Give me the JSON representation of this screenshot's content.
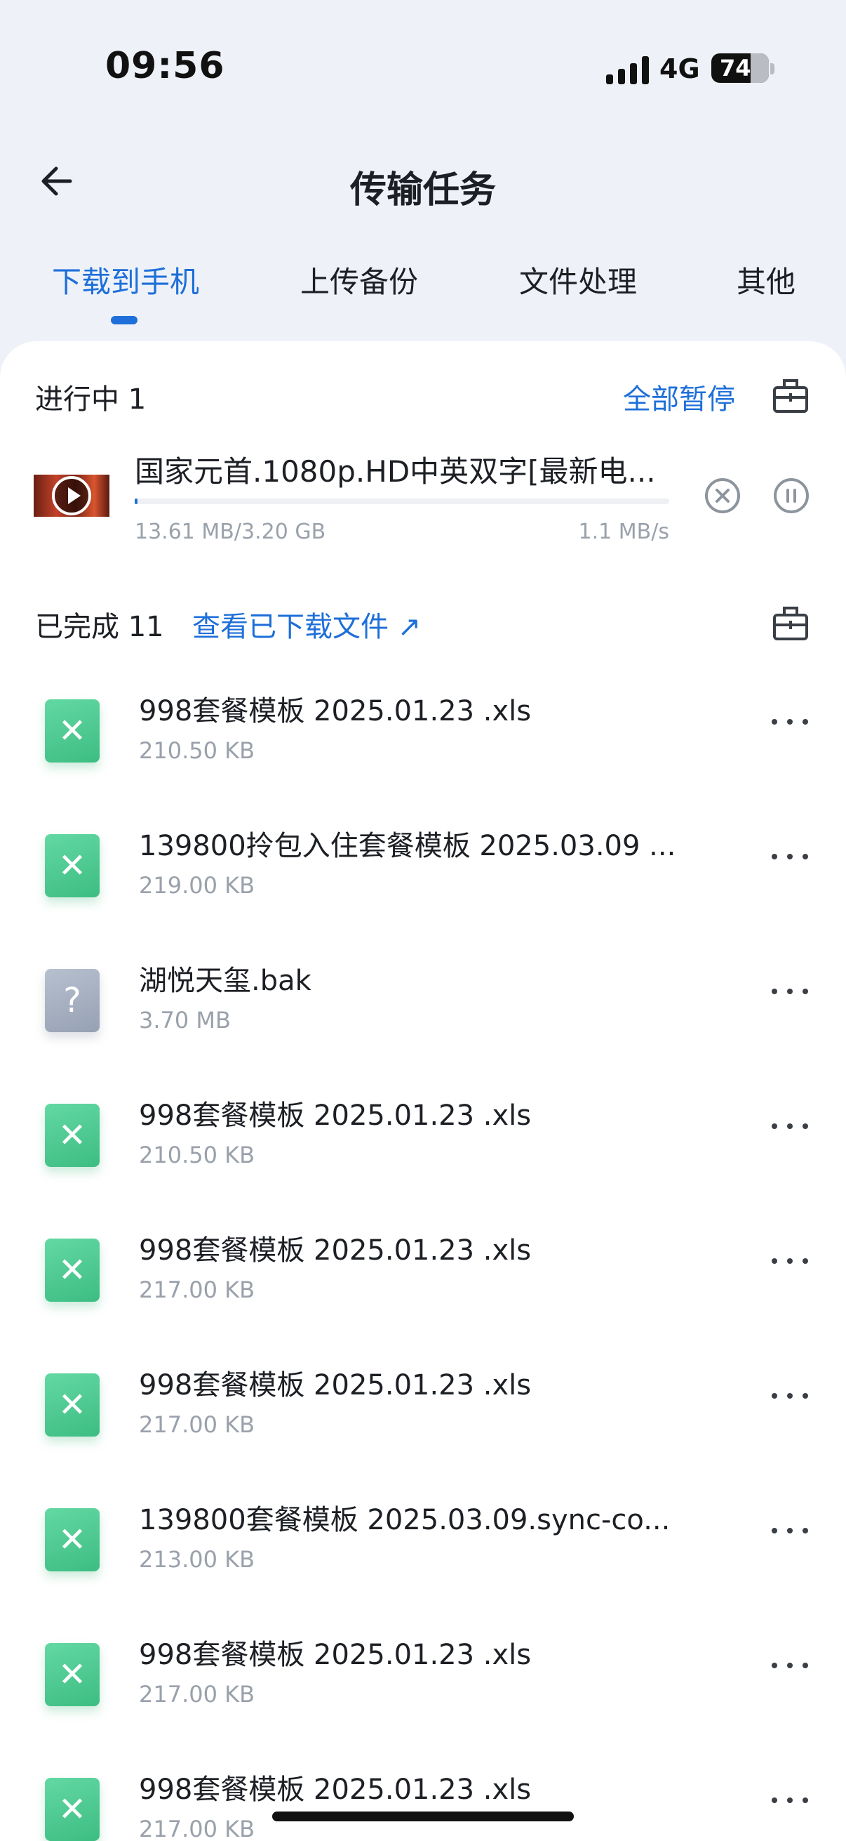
{
  "status_bar": {
    "time": "09:56",
    "network": "4G",
    "battery": "74"
  },
  "header": {
    "title": "传输任务",
    "back_icon": "back-arrow-icon"
  },
  "tabs": [
    {
      "label": "下载到手机",
      "active": true
    },
    {
      "label": "上传备份",
      "active": false
    },
    {
      "label": "文件处理",
      "active": false
    },
    {
      "label": "其他",
      "active": false
    }
  ],
  "in_progress": {
    "label": "进行中 1",
    "pause_all": "全部暂停",
    "item": {
      "name": "国家元首.1080p.HD中英双字[最新电...",
      "size": "13.61 MB/3.20 GB",
      "speed": "1.1 MB/s",
      "progress_fraction": 0.004
    }
  },
  "completed": {
    "label": "已完成 11",
    "view_link": "查看已下载文件 ↗",
    "items": [
      {
        "name": "998套餐模板 2025.01.23 .xls",
        "size": "210.50 KB",
        "type": "xls"
      },
      {
        "name": "139800拎包入住套餐模板 2025.03.09 ...",
        "size": "219.00 KB",
        "type": "xls"
      },
      {
        "name": "湖悦天玺.bak",
        "size": "3.70 MB",
        "type": "unknown"
      },
      {
        "name": "998套餐模板 2025.01.23 .xls",
        "size": "210.50 KB",
        "type": "xls"
      },
      {
        "name": "998套餐模板 2025.01.23 .xls",
        "size": "217.00 KB",
        "type": "xls"
      },
      {
        "name": "998套餐模板 2025.01.23 .xls",
        "size": "217.00 KB",
        "type": "xls"
      },
      {
        "name": "139800套餐模板 2025.03.09.sync-co...",
        "size": "213.00 KB",
        "type": "xls"
      },
      {
        "name": "998套餐模板 2025.01.23 .xls",
        "size": "217.00 KB",
        "type": "xls"
      },
      {
        "name": "998套餐模板 2025.01.23 .xls",
        "size": "217.00 KB",
        "type": "xls"
      }
    ]
  },
  "colors": {
    "accent": "#1e6fd9",
    "xls_green": "#3dbd82",
    "background": "#eef2f8"
  }
}
